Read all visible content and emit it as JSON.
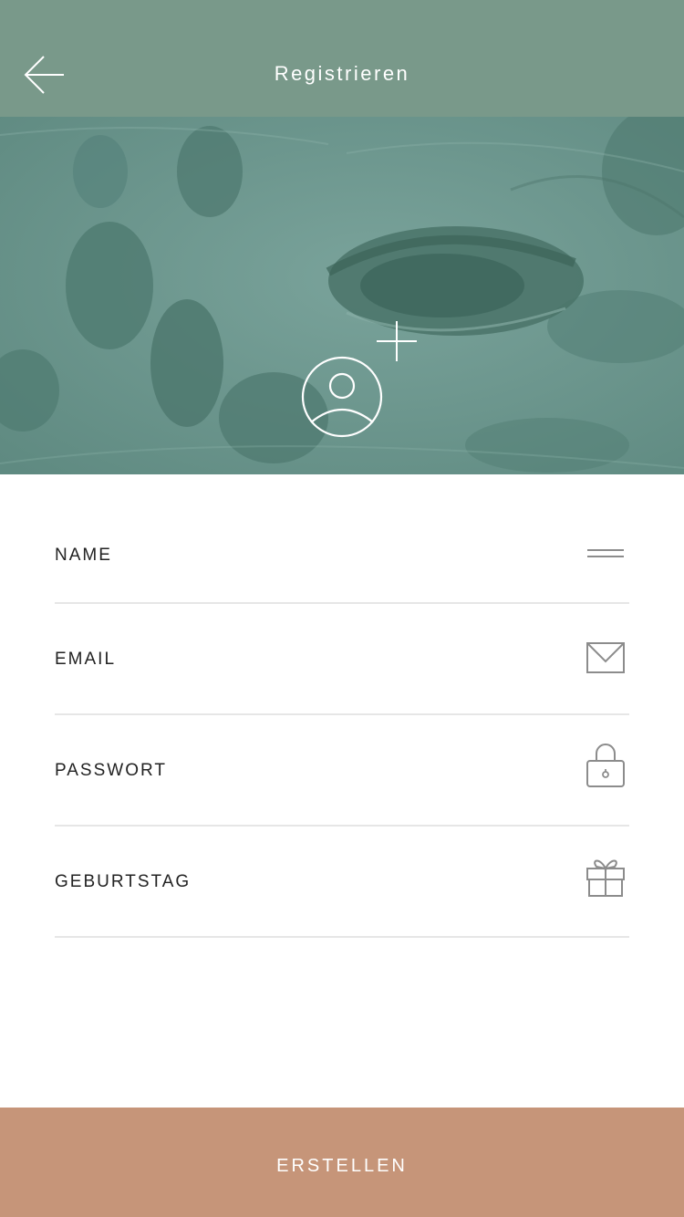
{
  "header": {
    "title": "Registrieren",
    "back_icon": "arrow-left-icon"
  },
  "hero": {
    "avatar_icon": "user-circle-icon",
    "add_icon": "plus-icon"
  },
  "form": {
    "fields": [
      {
        "label": "NAME",
        "icon": "menu-lines-icon"
      },
      {
        "label": "EMAIL",
        "icon": "envelope-icon"
      },
      {
        "label": "PASSWORT",
        "icon": "lock-icon"
      },
      {
        "label": "GEBURTSTAG",
        "icon": "gift-icon"
      }
    ]
  },
  "footer": {
    "create_label": "ERSTELLEN"
  },
  "colors": {
    "header": "#79998a",
    "hero": "#6f9a93",
    "button": "#c69579",
    "divider": "#e6e6e6"
  }
}
